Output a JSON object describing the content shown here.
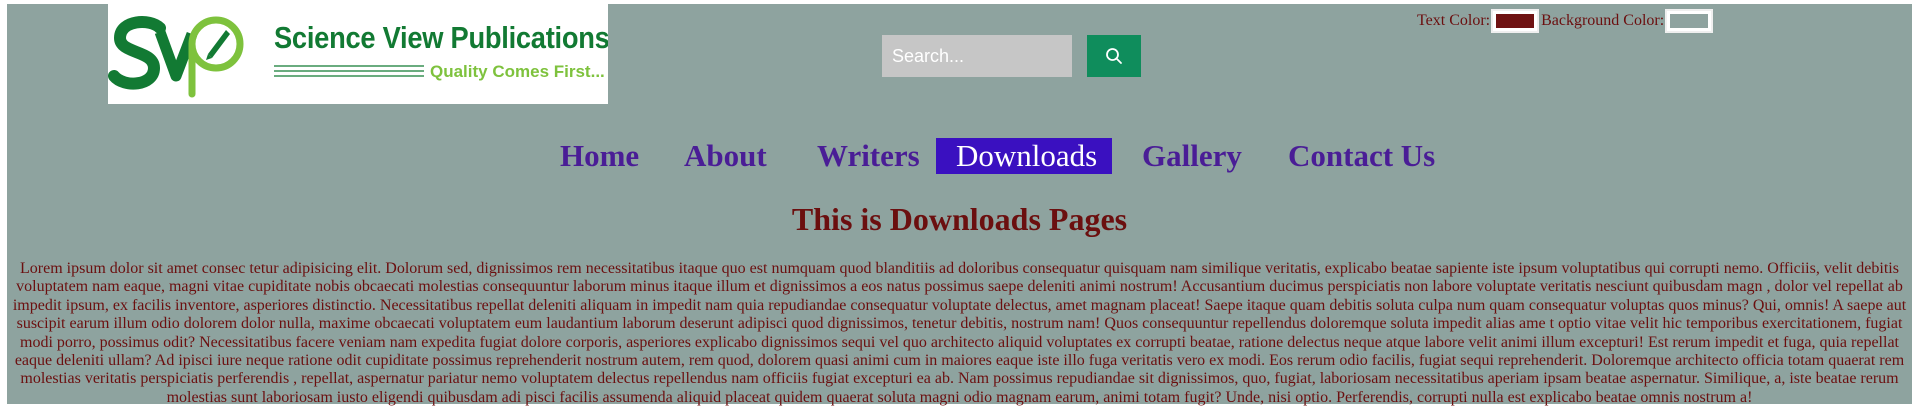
{
  "logo": {
    "title": "Science View Publications",
    "tagline": "Quality Comes First..."
  },
  "search": {
    "placeholder": "Search...",
    "icon": "search-icon"
  },
  "color_controls": {
    "text_color_label": "Text Color:",
    "text_color_value": "#6e1212",
    "background_color_label": "Background Color:",
    "background_color_value": "#8ea39f"
  },
  "nav": {
    "items": [
      {
        "label": "Home"
      },
      {
        "label": "About"
      },
      {
        "label": "Writers"
      },
      {
        "label": "Downloads",
        "active": true
      },
      {
        "label": "Gallery"
      },
      {
        "label": "Contact Us"
      }
    ]
  },
  "main": {
    "title": "This is Downloads Pages",
    "body": "Lorem ipsum dolor sit amet consec tetur adipisicing elit. Dolorum sed, dignissimos rem necessitatibus itaque quo est numquam quod blanditiis ad doloribus consequatur quisquam nam similique veritatis, explicabo beatae sapiente iste ipsum voluptatibus qui corrupti nemo. Officiis, velit debitis voluptatem nam eaque, magni vitae cupiditate nobis obcaecati molestias consequuntur laborum minus itaque illum et dignissimos a eos natus possimus saepe deleniti animi nostrum! Accusantium ducimus perspiciatis non labore voluptate veritatis nesciunt quibusdam magn , dolor vel repellat ab impedit ipsum, ex facilis inventore, asperiores distinctio. Necessitatibus repellat deleniti aliquam in impedit nam quia repudiandae consequatur voluptate delectus, amet magnam placeat! Saepe itaque quam debitis soluta culpa num quam consequatur voluptas quos minus? Qui, omnis! A saepe aut suscipit earum illum odio dolorem dolor nulla, maxime obcaecati voluptatem eum laudantium laborum deserunt adipisci quod dignissimos, tenetur debitis, nostrum nam! Quos consequuntur repellendus doloremque soluta impedit alias ame t optio vitae velit hic temporibus exercitationem, fugiat modi porro, possimus odit? Necessitatibus facere veniam nam expedita fugiat dolore corporis, asperiores explicabo dignissimos sequi vel quo architecto aliquid voluptates ex corrupti beatae, ratione delectus neque atque labore velit animi illum excepturi! Est rerum impedit et fuga, quia repellat eaque deleniti ullam? Ad ipisci iure neque ratione odit cupiditate possimus reprehenderit nostrum autem, rem quod, dolorem quasi animi cum in maiores eaque iste illo fuga veritatis vero ex modi. Eos rerum odio facilis, fugiat sequi reprehenderit. Doloremque architecto officia totam quaerat rem molestias veritatis perspiciatis perferendis , repellat, aspernatur pariatur nemo voluptatem delectus repellendus nam officiis fugiat excepturi ea ab. Nam possimus repudiandae sit dignissimos, quo, fugiat, laboriosam necessitatibus aperiam ipsam beatae aspernatur. Similique, a, iste beatae rerum molestias sunt laboriosam iusto eligendi quibusdam adi pisci facilis assumenda aliquid placeat quidem quaerat soluta magni odio magnam earum, animi totam fugit? Unde, nisi optio. Perferendis, corrupti nulla est explicabo beatae omnis nostrum a!"
  }
}
